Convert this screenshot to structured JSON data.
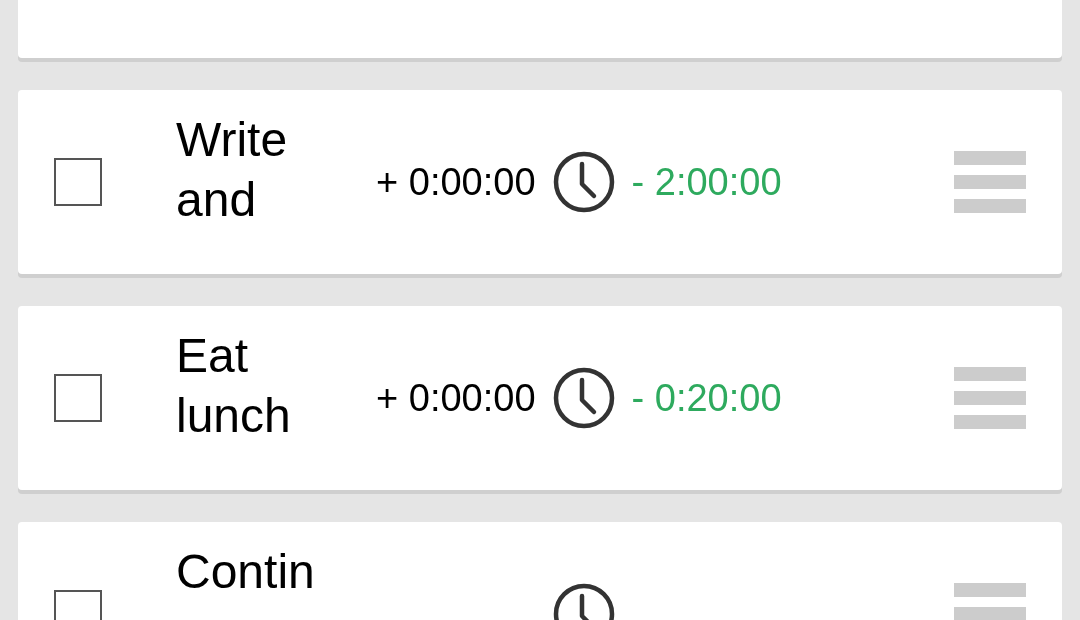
{
  "tasks": [
    {
      "title": "Write and",
      "checked": false,
      "elapsed": "+ 0:00:00",
      "remaining": "- 2:00:00"
    },
    {
      "title": "Eat lunch",
      "checked": false,
      "elapsed": "+ 0:00:00",
      "remaining": "- 0:20:00"
    },
    {
      "title": "Contin",
      "checked": false
    }
  ]
}
